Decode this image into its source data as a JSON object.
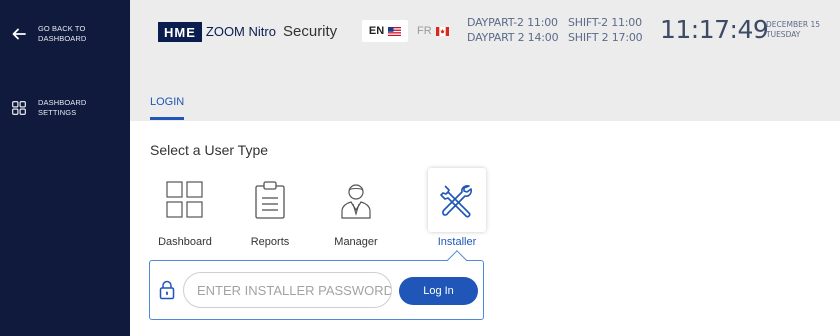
{
  "sidebar": {
    "back": {
      "line1": "GO BACK TO",
      "line2": "DASHBOARD"
    },
    "settings": {
      "line1": "DASHBOARD",
      "line2": "SETTINGS"
    }
  },
  "header": {
    "logo_hme": "HME",
    "logo_zoom": "ZOOM Nitro",
    "title": "Security",
    "lang_en": "EN",
    "lang_fr": "FR",
    "daypart_1": "DAYPART-2 11:00",
    "daypart_2": "DAYPART 2 14:00",
    "shift_1": "SHIFT-2 11:00",
    "shift_2": "SHIFT 2 17:00",
    "clock": "11:17:49",
    "date_line1": "DECEMBER 15",
    "date_line2": "TUESDAY"
  },
  "tabs": {
    "login": "LOGIN"
  },
  "main": {
    "title": "Select a User Type",
    "user_types": [
      {
        "label": "Dashboard",
        "icon": "dashboard-grid-icon"
      },
      {
        "label": "Reports",
        "icon": "clipboard-icon"
      },
      {
        "label": "Manager",
        "icon": "manager-person-icon"
      },
      {
        "label": "Installer",
        "icon": "tools-icon",
        "selected": true
      }
    ],
    "password_placeholder": "ENTER INSTALLER PASSWORD",
    "password_value": "",
    "login_button": "Log In"
  },
  "colors": {
    "sidebar_bg": "#0f1a3d",
    "header_bg": "#ececec",
    "accent": "#1f56b8"
  }
}
